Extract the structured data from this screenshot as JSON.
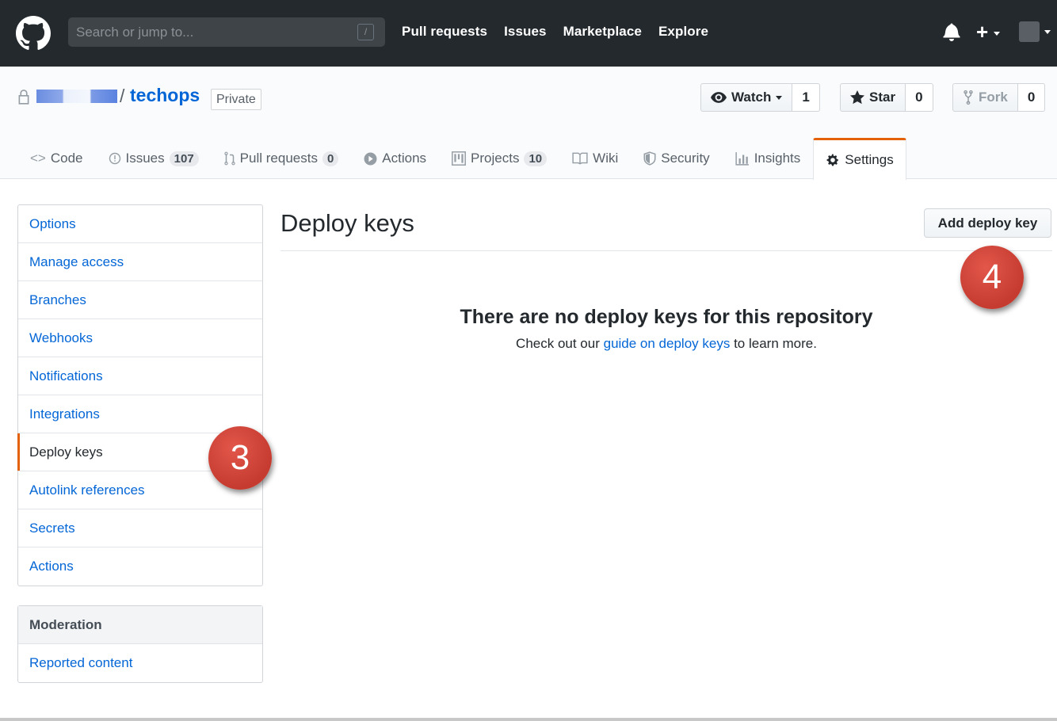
{
  "header": {
    "search_placeholder": "Search or jump to...",
    "search_shortcut": "/",
    "nav": [
      "Pull requests",
      "Issues",
      "Marketplace",
      "Explore"
    ]
  },
  "repo": {
    "name": "techops",
    "visibility": "Private",
    "watch": {
      "label": "Watch",
      "count": "1"
    },
    "star": {
      "label": "Star",
      "count": "0"
    },
    "fork": {
      "label": "Fork",
      "count": "0"
    }
  },
  "tabs": [
    {
      "label": "Code",
      "icon": "code-icon"
    },
    {
      "label": "Issues",
      "icon": "issue-icon",
      "count": "107"
    },
    {
      "label": "Pull requests",
      "icon": "pull-request-icon",
      "count": "0"
    },
    {
      "label": "Actions",
      "icon": "play-icon"
    },
    {
      "label": "Projects",
      "icon": "project-icon",
      "count": "10"
    },
    {
      "label": "Wiki",
      "icon": "book-icon"
    },
    {
      "label": "Security",
      "icon": "shield-icon"
    },
    {
      "label": "Insights",
      "icon": "graph-icon"
    },
    {
      "label": "Settings",
      "icon": "gear-icon",
      "selected": true
    }
  ],
  "sidebar": {
    "items": [
      "Options",
      "Manage access",
      "Branches",
      "Webhooks",
      "Notifications",
      "Integrations",
      "Deploy keys",
      "Autolink references",
      "Secrets",
      "Actions"
    ],
    "selected": "Deploy keys",
    "moderation": {
      "heading": "Moderation",
      "items": [
        "Reported content"
      ]
    }
  },
  "main": {
    "title": "Deploy keys",
    "add_button": "Add deploy key",
    "blank_title": "There are no deploy keys for this repository",
    "blank_pre": "Check out our ",
    "blank_link": "guide on deploy keys",
    "blank_post": " to learn more."
  },
  "callouts": {
    "step3": "3",
    "step4": "4"
  },
  "colors": {
    "header_bg": "#24292e",
    "link": "#0366d6",
    "accent": "#e36209",
    "callout": "#d0473b"
  }
}
